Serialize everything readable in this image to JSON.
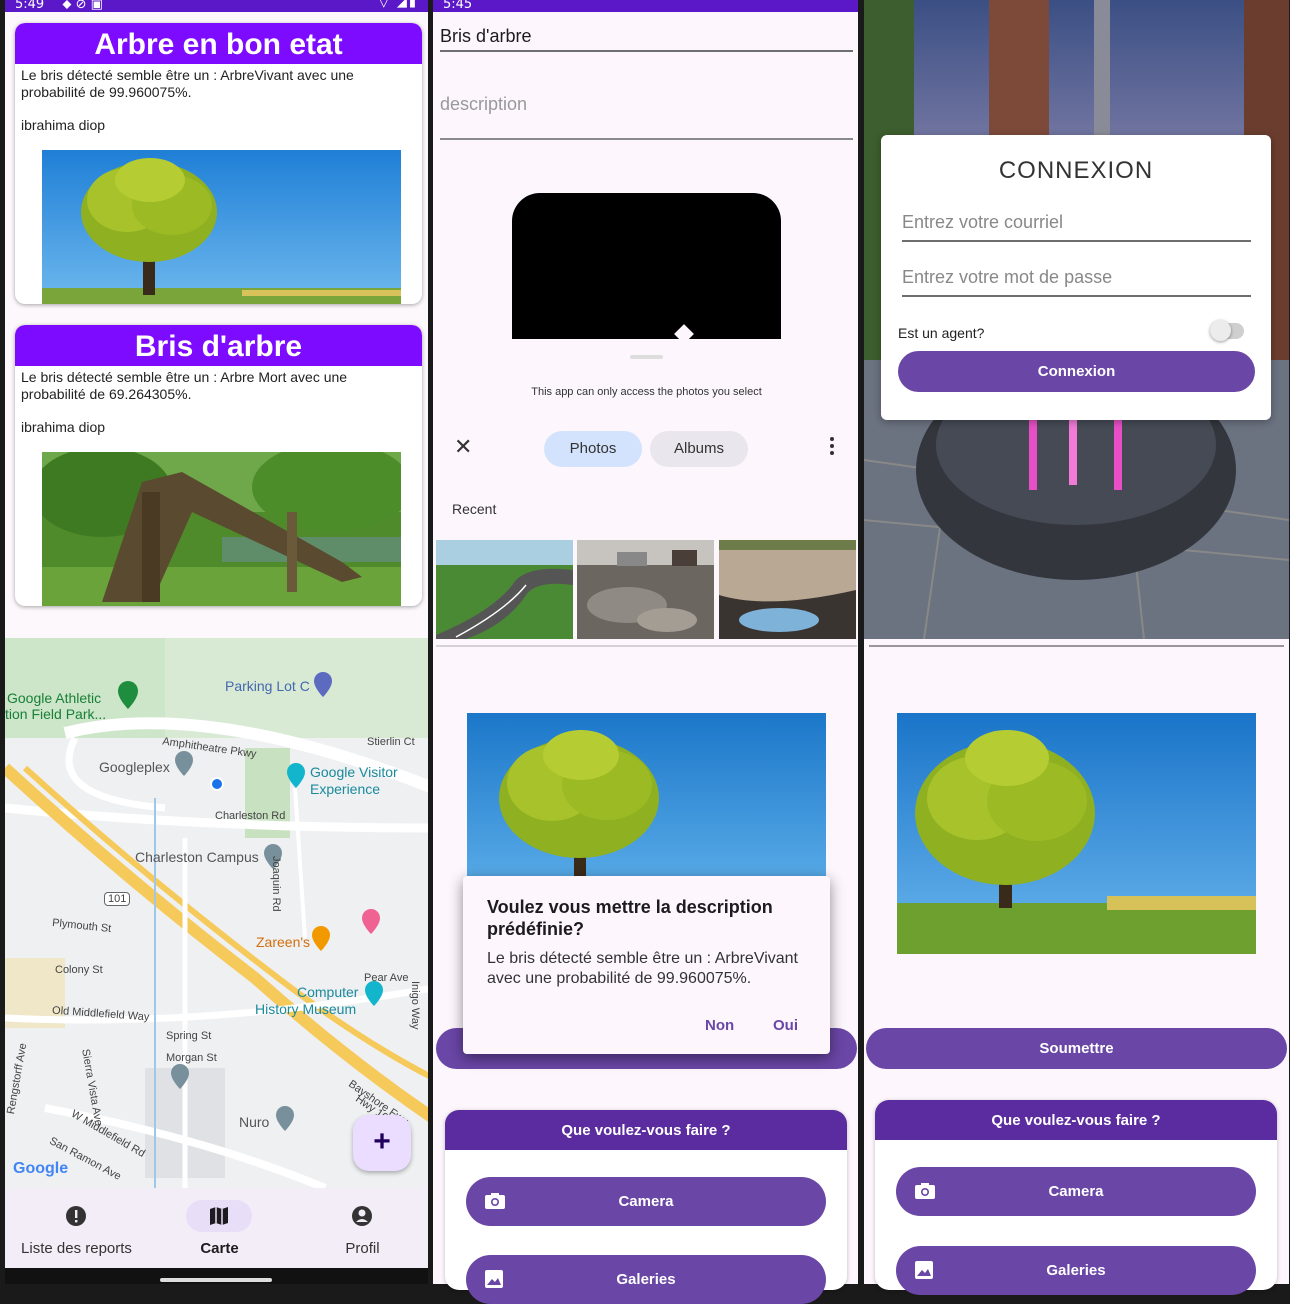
{
  "panel1": {
    "status_time": "5:49",
    "status_icons": "⬥ ⊘ ▣",
    "status_right": "▽ ◢▮",
    "reports": [
      {
        "title": "Arbre en bon etat",
        "description": "Le bris détecté semble être un : ArbreVivant avec une probabilité de 99.960075%.",
        "user": "ibrahima diop"
      },
      {
        "title": "Bris d'arbre",
        "description": "Le bris détecté semble être un : Arbre Mort avec une probabilité de 69.264305%.",
        "user": "ibrahima diop"
      }
    ],
    "map": {
      "labels": {
        "parking": "Parking Lot C",
        "athletic_1": "Google Athletic",
        "athletic_2": "tion Field Park...",
        "amphitheatre": "Amphitheatre Pkwy",
        "stierlin": "Stierlin Ct",
        "googleplex": "Googleplex",
        "visitor_1": "Google Visitor",
        "visitor_2": "Experience",
        "charleston_rd": "Charleston Rd",
        "charleston_campus": "Charleston Campus",
        "joaquin": "Joaquin Rd",
        "hwy101": "101",
        "plymouth": "Plymouth St",
        "zareens": "Zareen's",
        "colony": "Colony St",
        "pear": "Pear Ave",
        "computer_1": "Computer",
        "computer_2": "History Museum",
        "inigo": "Inigo Way",
        "old_middlefield": "Old Middlefield Way",
        "spring": "Spring St",
        "morgan": "Morgan St",
        "rengstorff": "Rengstorff Ave",
        "sierra": "Sierra Vista Ave",
        "bayshore_1": "Bayshore Fwy",
        "bayshore_2": "Hwy 10...",
        "nuro": "Nuro",
        "w_middlefield": "W Middlefield Rd",
        "san_ramon": "San Ramon Ave",
        "google": "Google"
      }
    },
    "fab_label": "+",
    "nav": [
      {
        "label": "Liste des reports"
      },
      {
        "label": "Carte"
      },
      {
        "label": "Profil"
      }
    ]
  },
  "panel2": {
    "status_time": "5:45",
    "title_value": "Bris d'arbre",
    "description_placeholder": "description",
    "picker_notice": "This app can only access the photos you select",
    "tab_photos": "Photos",
    "tab_albums": "Albums",
    "recent_label": "Recent",
    "submit_label": "Soumettre",
    "dialog": {
      "title": "Voulez vous mettre la description prédéfinie?",
      "body": "Le bris détecté semble être un : ArbreVivant avec une probabilité de 99.960075%.",
      "no": "Non",
      "yes": "Oui"
    },
    "choice_title": "Que voulez-vous faire ?",
    "camera_label": "Camera",
    "gallery_label": "Galeries"
  },
  "panel3": {
    "login_title": "CONNEXION",
    "email_placeholder": "Entrez votre courriel",
    "password_placeholder": "Entrez votre mot de passe",
    "agent_label": "Est un agent?",
    "login_button": "Connexion",
    "submit_label": "Soumettre",
    "choice_title": "Que voulez-vous faire ?",
    "camera_label": "Camera",
    "gallery_label": "Galeries"
  }
}
